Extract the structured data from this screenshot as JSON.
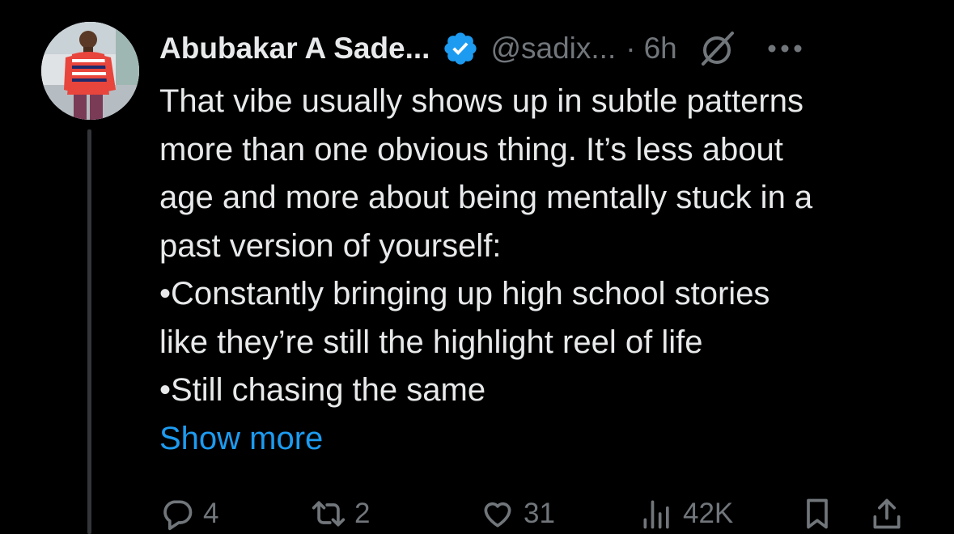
{
  "tweet": {
    "display_name": "Abubakar A Sade...",
    "handle": "@sadix...",
    "separator": "·",
    "time": "6h",
    "verified": true,
    "body_lines": [
      "That vibe usually shows up in subtle patterns",
      "more than one obvious thing. It’s less about",
      "age and more about being mentally stuck in a",
      "past version of yourself:",
      "•Constantly bringing up high school stories",
      "like they’re still the highlight reel of life",
      "•Still chasing the same"
    ],
    "show_more": "Show more"
  },
  "actions": {
    "replies": "4",
    "reposts": "2",
    "likes": "31",
    "views": "42K"
  },
  "icons": {
    "verified": "verified-badge-icon",
    "grok": "grok-icon",
    "more": "more-horizontal-icon",
    "reply": "reply-icon",
    "repost": "repost-icon",
    "like": "heart-icon",
    "views": "views-icon",
    "bookmark": "bookmark-icon",
    "share": "share-icon"
  },
  "colors": {
    "background": "#000000",
    "text": "#e7e9ea",
    "secondary": "#71767b",
    "link": "#1d9bf0",
    "verified": "#1d9bf0",
    "thread_line": "#333639"
  }
}
